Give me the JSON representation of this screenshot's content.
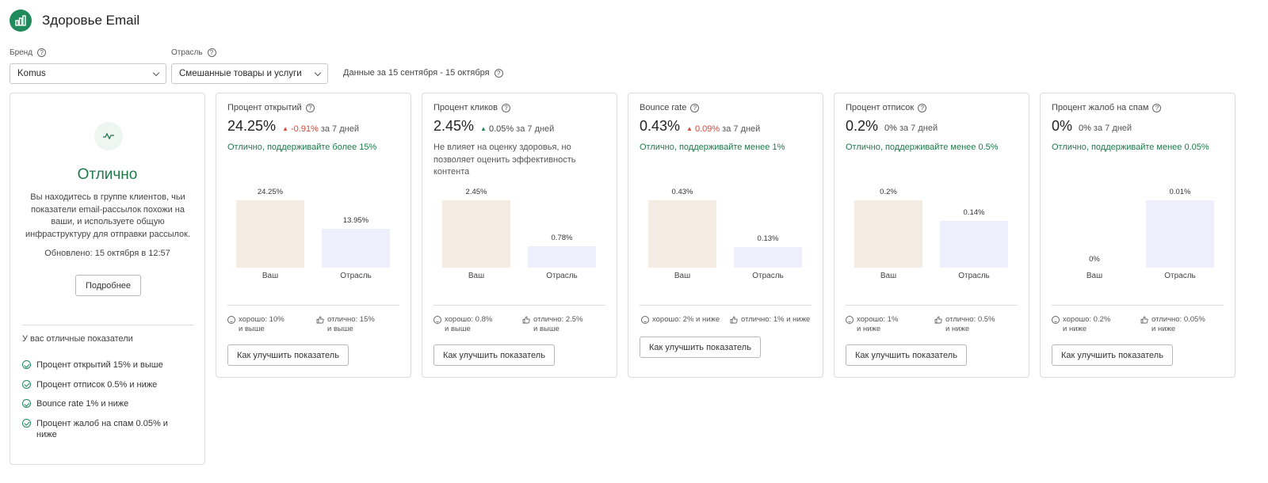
{
  "app": {
    "title": "Здоровье Email",
    "logo_icon": "bar-chart-icon",
    "brand_color": "#1f8a5b"
  },
  "filters": {
    "brand": {
      "label": "Бренд",
      "value": "Komus"
    },
    "industry": {
      "label": "Отрасль",
      "value": "Смешанные товары и услуги"
    },
    "date_range": "Данные за 15 сентября - 15 октября"
  },
  "health": {
    "status": "Отлично",
    "status_color": "#1f7a4a",
    "description": "Вы находитесь в группе клиентов, чьи показатели email-рассылок похожи на ваши, и используете общую инфраструктуру для отправки рассылок.",
    "updated": "Обновлено: 15 октября в 12:57",
    "more_button": "Подробнее",
    "good_title": "У вас отличные показатели",
    "good_items": [
      "Процент открытий 15% и выше",
      "Процент отписок 0.5% и ниже",
      "Bounce rate 1% и ниже",
      "Процент жалоб на спам 0.05% и ниже"
    ]
  },
  "metrics": [
    {
      "title": "Процент открытий",
      "value": "24.25%",
      "change": "-0.91%",
      "change_suffix": "за 7 дней",
      "change_dir": "up-red",
      "note": "Отлично, поддерживайте более 15%",
      "note_type": "good",
      "you_value": 24.25,
      "you_label": "24.25%",
      "industry_value": 13.95,
      "industry_label": "13.95%",
      "you_axis_label": "Ваш",
      "industry_axis_label": "Отрасль",
      "good": "хорошо: 10%\nи выше",
      "excellent": "отлично: 15%\nи выше",
      "button": "Как улучшить показатель"
    },
    {
      "title": "Процент кликов",
      "value": "2.45%",
      "change": "0.05%",
      "change_suffix": "за 7 дней",
      "change_dir": "up-green",
      "note": "Не влияет на оценку здоровья, но позволяет оценить эффективность контента",
      "note_type": "neutral",
      "you_value": 2.45,
      "you_label": "2.45%",
      "industry_value": 0.78,
      "industry_label": "0.78%",
      "you_axis_label": "Ваш",
      "industry_axis_label": "Отрасль",
      "good": "хорошо: 0.8%\nи выше",
      "excellent": "отлично: 2.5%\nи выше",
      "button": "Как улучшить показатель"
    },
    {
      "title": "Bounce rate",
      "value": "0.43%",
      "change": "0.09%",
      "change_suffix": "за 7 дней",
      "change_dir": "up-red",
      "note": "Отлично, поддерживайте менее 1%",
      "note_type": "good",
      "you_value": 0.43,
      "you_label": "0.43%",
      "industry_value": 0.13,
      "industry_label": "0.13%",
      "you_axis_label": "Ваш",
      "industry_axis_label": "Отрасль",
      "good": "хорошо: 2% и ниже",
      "excellent": "отлично: 1% и ниже",
      "button": "Как улучшить показатель"
    },
    {
      "title": "Процент отписок",
      "value": "0.2%",
      "change": "0%",
      "change_suffix": "за 7 дней",
      "change_dir": "none",
      "note": "Отлично, поддерживайте менее 0.5%",
      "note_type": "good",
      "you_value": 0.2,
      "you_label": "0.2%",
      "industry_value": 0.14,
      "industry_label": "0.14%",
      "you_axis_label": "Ваш",
      "industry_axis_label": "Отрасль",
      "good": "хорошо: 1%\nи ниже",
      "excellent": "отлично: 0.5%\nи ниже",
      "button": "Как улучшить показатель"
    },
    {
      "title": "Процент жалоб на спам",
      "value": "0%",
      "change": "0%",
      "change_suffix": "за 7 дней",
      "change_dir": "none",
      "note": "Отлично, поддерживайте менее 0.05%",
      "note_type": "good",
      "you_value": 0,
      "you_label": "0%",
      "industry_value": 0.01,
      "industry_label": "0.01%",
      "you_axis_label": "Ваш",
      "industry_axis_label": "Отрасль",
      "good": "хорошо: 0.2%\nи ниже",
      "excellent": "отлично: 0.05%\nи ниже",
      "button": "Как улучшить показатель"
    }
  ]
}
